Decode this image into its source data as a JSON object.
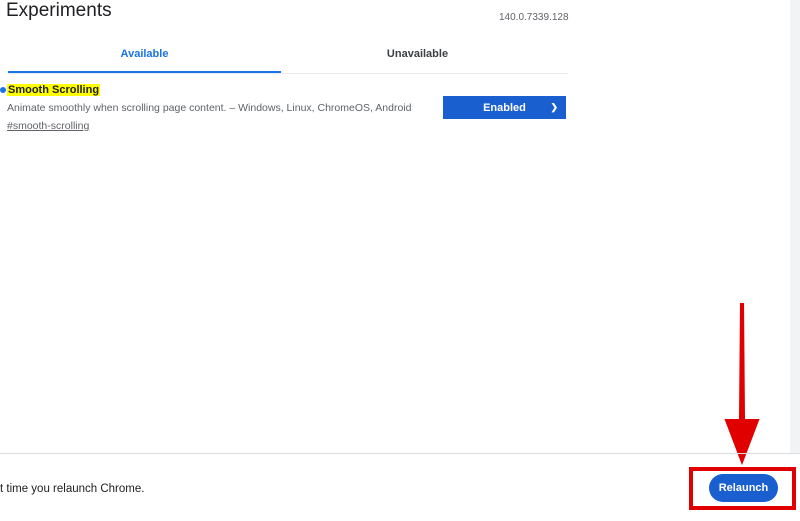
{
  "header": {
    "title": "Experiments",
    "version": "140.0.7339.128"
  },
  "tabs": [
    {
      "label": "Available",
      "active": true
    },
    {
      "label": "Unavailable",
      "active": false
    }
  ],
  "flag": {
    "name": "Smooth Scrolling",
    "description": "Animate smoothly when scrolling page content. – Windows, Linux, ChromeOS, Android",
    "link": "#smooth-scrolling",
    "selected": "Enabled"
  },
  "footer": {
    "message": "t time you relaunch Chrome.",
    "relaunch_label": "Relaunch"
  },
  "colors": {
    "accent": "#1a73e8",
    "button": "#1a5fd0",
    "highlight": "#ffff00",
    "annotation": "#e00000"
  }
}
